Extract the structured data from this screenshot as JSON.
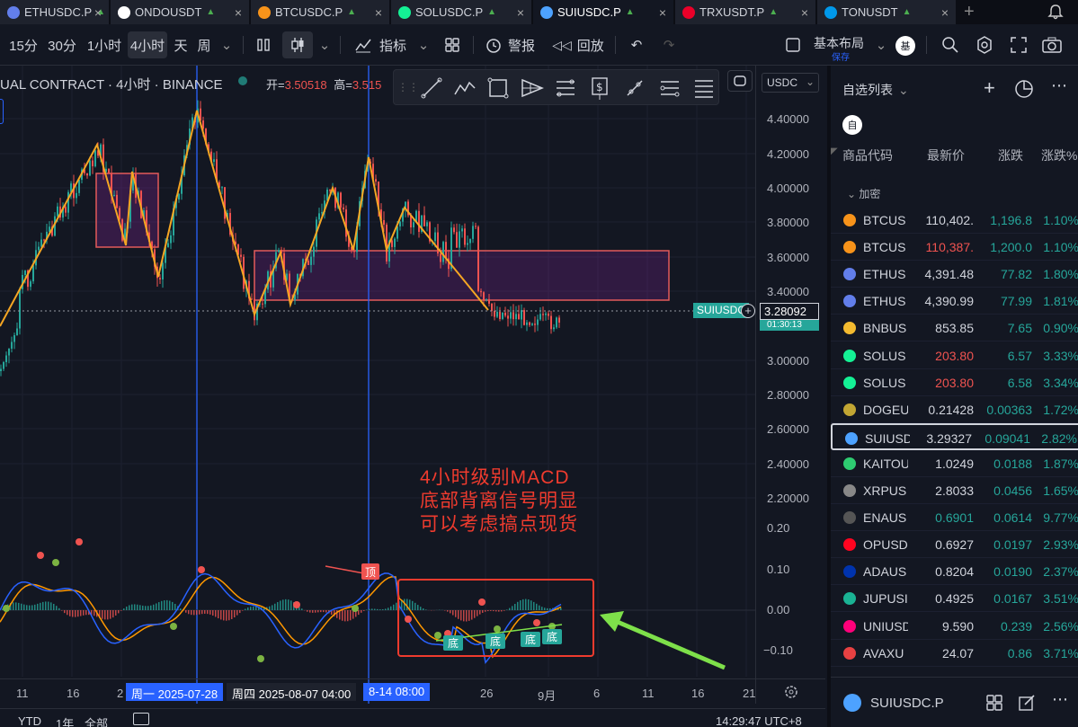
{
  "tabs": [
    {
      "label": "ETHUSDC.P",
      "color": "#627eea"
    },
    {
      "label": "ONDOUSDT",
      "color": "#ffffff"
    },
    {
      "label": "BTCUSDC.P",
      "color": "#f7931a"
    },
    {
      "label": "SOLUSDC.P",
      "color": "#14f195"
    },
    {
      "label": "SUIUSDC.P",
      "color": "#4da2ff"
    },
    {
      "label": "TRXUSDT.P",
      "color": "#eb0029"
    },
    {
      "label": "TONUSDT",
      "color": "#0098ea"
    }
  ],
  "toolbar": {
    "intervals": [
      "15分",
      "30分",
      "1小时",
      "4小时",
      "天",
      "周"
    ],
    "indicators_label": "指标",
    "alert_label": "警报",
    "replay_label": "回放",
    "layout_label": "基本布局",
    "layout_sub": "保存",
    "user_avatar": "基"
  },
  "chart": {
    "title": "UAL CONTRACT · 4小时 · BINANCE",
    "ohlc_open_label": "开=",
    "ohlc_open": "3.50518",
    "ohlc_high_label": "高=",
    "ohlc_high": "3.515",
    "currency": "USDC",
    "symbol_tag": "SUIUSDC",
    "last_price": "3.28092",
    "countdown": "01:30:13",
    "price_labels": [
      "4.40000",
      "4.20000",
      "4.00000",
      "3.80000",
      "3.60000",
      "3.40000",
      "3.00000",
      "2.80000",
      "2.60000",
      "2.40000",
      "2.20000"
    ],
    "macd_labels": [
      "0.20",
      "0.10",
      "0.00",
      "−0.10"
    ],
    "annotation_lines": [
      "4小时级别MACD",
      "底部背离信号明显",
      "可以考虑搞点现货"
    ],
    "top_label": "顶",
    "bottom_label": "底",
    "colors": {
      "up": "#26a69a",
      "down": "#ef5350",
      "zigzag": "#f5a623",
      "box": "#e35b5b",
      "macd_blue": "#2962ff",
      "macd_orange": "#ff9800",
      "arrow": "#7ee04a"
    }
  },
  "time_axis": {
    "labels": [
      "11",
      "16",
      "2",
      "26",
      "9月",
      "6",
      "11",
      "16",
      "21"
    ],
    "sel1": "周一 2025-07-28",
    "sel2": "周四 2025-08-07  04:00",
    "sel3": "8-14  08:00"
  },
  "bottom_bar": {
    "ranges": [
      "YTD",
      "1年",
      "全部"
    ],
    "time": "14:29:47 UTC+8"
  },
  "watchlist": {
    "title": "自选列表",
    "avatar": "自",
    "columns": [
      "商品代码",
      "最新价",
      "涨跌",
      "涨跌%"
    ],
    "section": "加密",
    "rows": [
      {
        "symbol": "BTCUS",
        "last": "110,402.",
        "chg": "1,196.8",
        "pct": "1.10%",
        "color": "#f7931a",
        "last_color": "#d1d4dc"
      },
      {
        "symbol": "BTCUS",
        "last": "110,387.",
        "chg": "1,200.0",
        "pct": "1.10%",
        "color": "#f7931a",
        "last_color": "#ef5350"
      },
      {
        "symbol": "ETHUS",
        "last": "4,391.48",
        "chg": "77.82",
        "pct": "1.80%",
        "color": "#627eea",
        "last_color": "#d1d4dc"
      },
      {
        "symbol": "ETHUS",
        "last": "4,390.99",
        "chg": "77.99",
        "pct": "1.81%",
        "color": "#627eea",
        "last_color": "#d1d4dc"
      },
      {
        "symbol": "BNBUS",
        "last": "853.85",
        "chg": "7.65",
        "pct": "0.90%",
        "color": "#f3ba2f",
        "last_color": "#d1d4dc"
      },
      {
        "symbol": "SOLUS",
        "last": "203.80",
        "chg": "6.57",
        "pct": "3.33%",
        "color": "#14f195",
        "last_color": "#ef5350"
      },
      {
        "symbol": "SOLUS",
        "last": "203.80",
        "chg": "6.58",
        "pct": "3.34%",
        "color": "#14f195",
        "last_color": "#ef5350"
      },
      {
        "symbol": "DOGEU",
        "last": "0.21428",
        "chg": "0.00363",
        "pct": "1.72%",
        "color": "#c2a633",
        "last_color": "#d1d4dc"
      },
      {
        "symbol": "SUIUSD",
        "last": "3.29327",
        "chg": "0.09041",
        "pct": "2.82%",
        "color": "#4da2ff",
        "last_color": "#d1d4dc"
      },
      {
        "symbol": "KAITOU",
        "last": "1.0249",
        "chg": "0.0188",
        "pct": "1.87%",
        "color": "#2ecc71",
        "last_color": "#d1d4dc"
      },
      {
        "symbol": "XRPUS",
        "last": "2.8033",
        "chg": "0.0456",
        "pct": "1.65%",
        "color": "#888888",
        "last_color": "#d1d4dc"
      },
      {
        "symbol": "ENAUS",
        "last": "0.6901",
        "chg": "0.0614",
        "pct": "9.77%",
        "color": "#555555",
        "last_color": "#26a69a"
      },
      {
        "symbol": "OPUSD",
        "last": "0.6927",
        "chg": "0.0197",
        "pct": "2.93%",
        "color": "#ff0420",
        "last_color": "#d1d4dc"
      },
      {
        "symbol": "ADAUS",
        "last": "0.8204",
        "chg": "0.0190",
        "pct": "2.37%",
        "color": "#0033ad",
        "last_color": "#d1d4dc"
      },
      {
        "symbol": "JUPUSI",
        "last": "0.4925",
        "chg": "0.0167",
        "pct": "3.51%",
        "color": "#1ab394",
        "last_color": "#d1d4dc"
      },
      {
        "symbol": "UNIUSD",
        "last": "9.590",
        "chg": "0.239",
        "pct": "2.56%",
        "color": "#ff007a",
        "last_color": "#d1d4dc"
      },
      {
        "symbol": "AVAXU",
        "last": "24.07",
        "chg": "0.86",
        "pct": "3.71%",
        "color": "#e84142",
        "last_color": "#d1d4dc"
      }
    ],
    "footer_symbol": "SUIUSDC.P"
  }
}
